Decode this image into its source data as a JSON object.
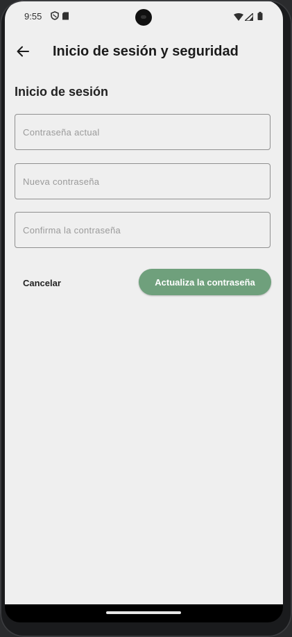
{
  "status_bar": {
    "time": "9:55",
    "left_icons": [
      "shield-icon",
      "sd-card-icon"
    ],
    "right_icons": [
      "wifi-icon",
      "signal-icon",
      "battery-icon"
    ]
  },
  "app_bar": {
    "back_icon": "arrow-left-icon",
    "title": "Inicio de sesión y seguridad"
  },
  "section": {
    "title": "Inicio de sesión"
  },
  "form": {
    "current_password": {
      "value": "",
      "placeholder": "Contraseña actual"
    },
    "new_password": {
      "value": "",
      "placeholder": "Nueva contraseña"
    },
    "confirm_password": {
      "value": "",
      "placeholder": "Confirma la contraseña"
    }
  },
  "actions": {
    "cancel_label": "Cancelar",
    "update_label": "Actualiza la contraseña"
  },
  "colors": {
    "background": "#efefef",
    "accent_button": "#6fa07c",
    "accent_button_text": "#ffffff",
    "title_text": "#1b1b1b"
  }
}
